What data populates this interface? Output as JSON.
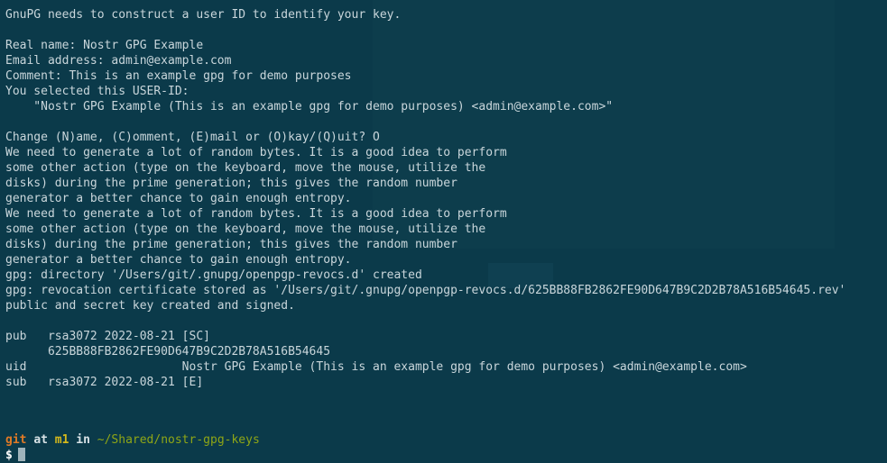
{
  "window": {
    "background": "#0b3a4a",
    "foreground": "#c9d6db"
  },
  "output_lines": [
    "",
    "GnuPG needs to construct a user ID to identify your key.",
    "",
    "Real name: Nostr GPG Example",
    "Email address: admin@example.com",
    "Comment: This is an example gpg for demo purposes",
    "You selected this USER-ID:",
    "    \"Nostr GPG Example (This is an example gpg for demo purposes) <admin@example.com>\"",
    "",
    "Change (N)ame, (C)omment, (E)mail or (O)kay/(Q)uit? O",
    "We need to generate a lot of random bytes. It is a good idea to perform",
    "some other action (type on the keyboard, move the mouse, utilize the",
    "disks) during the prime generation; this gives the random number",
    "generator a better chance to gain enough entropy.",
    "We need to generate a lot of random bytes. It is a good idea to perform",
    "some other action (type on the keyboard, move the mouse, utilize the",
    "disks) during the prime generation; this gives the random number",
    "generator a better chance to gain enough entropy.",
    "gpg: directory '/Users/git/.gnupg/openpgp-revocs.d' created",
    "gpg: revocation certificate stored as '/Users/git/.gnupg/openpgp-revocs.d/625BB88FB2862FE90D647B9C2D2B78A516B54645.rev'",
    "public and secret key created and signed.",
    "",
    "pub   rsa3072 2022-08-21 [SC]",
    "      625BB88FB2862FE90D647B9C2D2B78A516B54645",
    "uid                      Nostr GPG Example (This is an example gpg for demo purposes) <admin@example.com>",
    "sub   rsa3072 2022-08-21 [E]",
    "",
    ""
  ],
  "prompt": {
    "user": "git",
    "at": "at",
    "branch": "m1",
    "in": "in",
    "path": "~/Shared/nostr-gpg-keys",
    "symbol": "$"
  },
  "colors": {
    "user": "#e07a26",
    "branch": "#d6b91c",
    "path": "#8fa616"
  }
}
